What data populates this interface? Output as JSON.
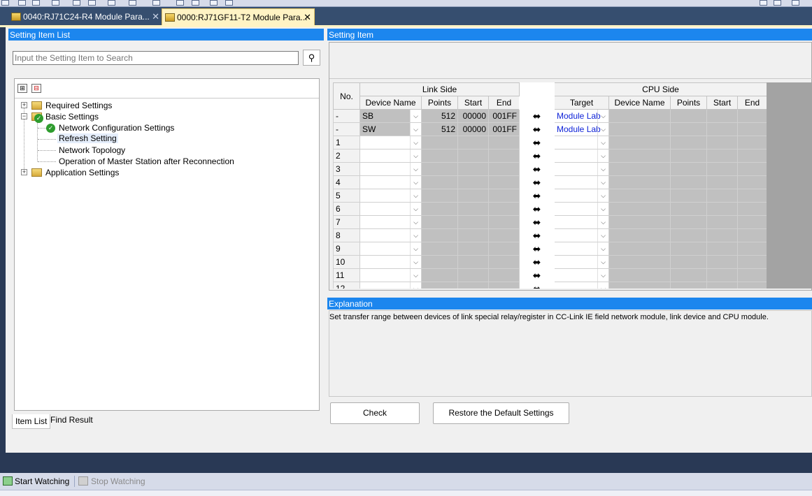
{
  "tabs": [
    {
      "label": "0040:RJ71C24-R4 Module Para...",
      "active": false
    },
    {
      "label": "0000:RJ71GF11-T2 Module Para...",
      "active": true
    }
  ],
  "left_panel": {
    "title": "Setting Item List",
    "search_placeholder": "Input the Setting Item to Search",
    "tree": [
      {
        "label": "Required Settings",
        "level": 0,
        "expanded": false
      },
      {
        "label": "Basic Settings",
        "level": 0,
        "expanded": true
      },
      {
        "label": "Network Configuration Settings",
        "level": 1
      },
      {
        "label": "Refresh Setting",
        "level": 1,
        "selected": true
      },
      {
        "label": "Network Topology",
        "level": 1
      },
      {
        "label": "Operation of Master Station after Reconnection",
        "level": 1
      },
      {
        "label": "Application Settings",
        "level": 0,
        "expanded": false
      }
    ],
    "bottom_tabs": [
      "Item List",
      "Find Result"
    ]
  },
  "right_panel": {
    "title": "Setting Item",
    "headers": {
      "no": "No.",
      "link_side": "Link Side",
      "cpu_side": "CPU Side",
      "link_cols": [
        "Device Name",
        "Points",
        "Start",
        "End"
      ],
      "cpu_cols": [
        "Target",
        "Device Name",
        "Points",
        "Start",
        "End"
      ]
    },
    "rows": [
      {
        "no": "-",
        "device": "SB",
        "points": "512",
        "start": "00000",
        "end": "001FF",
        "target": "Module Lab"
      },
      {
        "no": "-",
        "device": "SW",
        "points": "512",
        "start": "00000",
        "end": "001FF",
        "target": "Module Lab"
      },
      {
        "no": "1"
      },
      {
        "no": "2"
      },
      {
        "no": "3"
      },
      {
        "no": "4"
      },
      {
        "no": "5"
      },
      {
        "no": "6"
      },
      {
        "no": "7"
      },
      {
        "no": "8"
      },
      {
        "no": "9"
      },
      {
        "no": "10"
      },
      {
        "no": "11"
      },
      {
        "no": "12"
      }
    ],
    "explanation_title": "Explanation",
    "explanation_text": "Set transfer range between devices of link special relay/register in CC-Link IE field network module, link device and CPU module.",
    "buttons": {
      "check": "Check",
      "restore": "Restore the Default Settings"
    }
  },
  "statusbar": {
    "start_watching": "Start Watching",
    "stop_watching": "Stop Watching"
  }
}
